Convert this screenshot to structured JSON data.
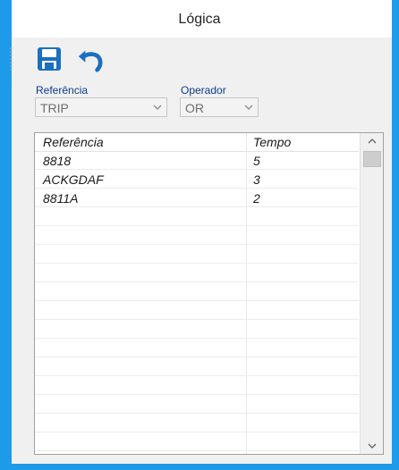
{
  "window": {
    "title": "Lógica",
    "accent_color": "#1e9be8"
  },
  "toolbar": {
    "save_icon": "save-icon",
    "undo_icon": "undo-icon"
  },
  "filters": {
    "referencia_label": "Referência",
    "referencia_value": "TRIP",
    "operador_label": "Operador",
    "operador_value": "OR"
  },
  "grid": {
    "columns": [
      "Referência",
      "Tempo"
    ],
    "rows": [
      {
        "referencia": "8818",
        "tempo": "5"
      },
      {
        "referencia": "ACKGDAF",
        "tempo": "3"
      },
      {
        "referencia": "8811A",
        "tempo": "2"
      }
    ]
  }
}
